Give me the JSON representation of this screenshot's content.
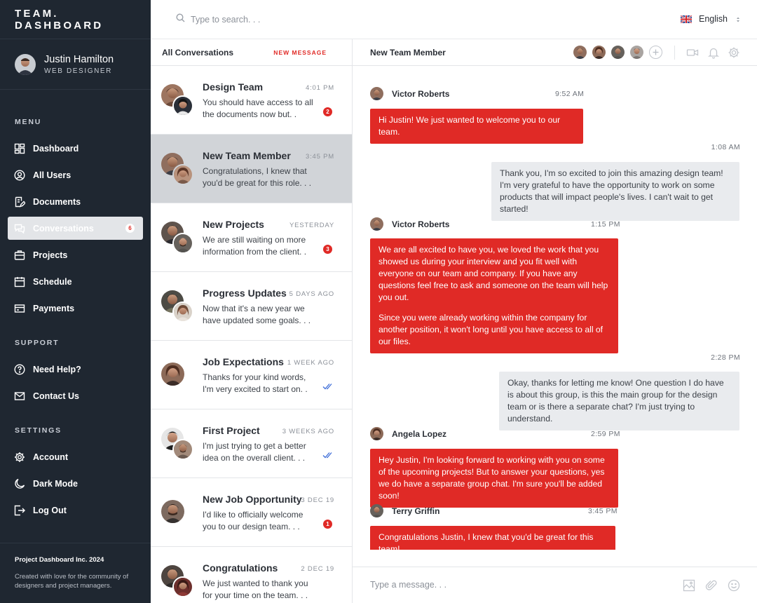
{
  "brand": "TEAM. DASHBOARD",
  "user": {
    "name": "Justin Hamilton",
    "role": "WEB DESIGNER"
  },
  "menu": {
    "title": "MENU",
    "items": [
      {
        "label": "Dashboard",
        "icon": "dashboard-icon"
      },
      {
        "label": "All Users",
        "icon": "user-circle-icon"
      },
      {
        "label": "Documents",
        "icon": "document-icon"
      },
      {
        "label": "Conversations",
        "icon": "chat-icon",
        "badge": "6",
        "active": true
      },
      {
        "label": "Projects",
        "icon": "briefcase-icon"
      },
      {
        "label": "Schedule",
        "icon": "calendar-icon"
      },
      {
        "label": "Payments",
        "icon": "card-icon"
      }
    ]
  },
  "support": {
    "title": "SUPPORT",
    "items": [
      {
        "label": "Need Help?",
        "icon": "question-icon"
      },
      {
        "label": "Contact Us",
        "icon": "mail-icon"
      }
    ]
  },
  "settings": {
    "title": "SETTINGS",
    "items": [
      {
        "label": "Account",
        "icon": "gear-icon"
      },
      {
        "label": "Dark Mode",
        "icon": "moon-icon"
      },
      {
        "label": "Log Out",
        "icon": "logout-icon"
      }
    ]
  },
  "footer": {
    "company": "Project Dashboard Inc. 2024",
    "tagline": "Created with love for the community of designers and project managers."
  },
  "topbar": {
    "search_placeholder": "Type to search. . .",
    "language": "English"
  },
  "conversations": {
    "title": "All Conversations",
    "new_message": "NEW MESSAGE",
    "items": [
      {
        "title": "Design Team",
        "time": "4:01 PM",
        "preview": "You should have access to all the documents now but. .",
        "unread": "2"
      },
      {
        "title": "New Team Member",
        "time": "3:45 PM",
        "preview": "Congratulations, I knew that you'd be great for this role. . .",
        "selected": true
      },
      {
        "title": "New Projects",
        "time": "YESTERDAY",
        "preview": "We are still waiting on more information from the client. .",
        "unread": "3"
      },
      {
        "title": "Progress Updates",
        "time": "5 DAYS AGO",
        "preview": "Now that it's a new year we have updated some goals. . ."
      },
      {
        "title": "Job Expectations",
        "time": "1 WEEK AGO",
        "preview": "Thanks for your kind words, I'm very excited to start on. .",
        "read": true
      },
      {
        "title": "First Project",
        "time": "3 WEEKS AGO",
        "preview": "I'm just trying to get a better idea on the overall client. . .",
        "read": true
      },
      {
        "title": "New Job Opportunity",
        "time": "3 DEC 19",
        "preview": "I'd like to officially welcome you to our design team. . .",
        "unread": "1"
      },
      {
        "title": "Congratulations",
        "time": "2 DEC 19",
        "preview": "We just wanted to thank you for your time on the team. . ."
      }
    ]
  },
  "chat": {
    "title": "New Team Member",
    "messages": [
      {
        "sender": "Victor Roberts",
        "time": "9:52 AM",
        "text": "Hi Justin! We just wanted to welcome you to our team."
      },
      {
        "time": "1:08 AM",
        "text": "Thank you, I'm so excited to join this amazing design team! I'm very grateful to have the opportunity to work on some products that will impact people's lives. I can't wait to get started!"
      },
      {
        "sender": "Victor Roberts",
        "time": "1:15 PM",
        "text": "We are all excited to have you, we loved the work that you showed us during your interview and you fit well with everyone on our team and company. If you have any questions feel free to ask and someone on the team will help you out."
      },
      {
        "text": "Since you were already working within the company for another position, it won't long until you have access to all of our files."
      },
      {
        "time": "2:28 PM",
        "text": "Okay, thanks for letting me know! One question I do have is about this group, is this the main group for the design team or is there a separate chat? I'm just trying to understand."
      },
      {
        "sender": "Angela Lopez",
        "time": "2:59 PM",
        "text": "Hey Justin, I'm looking forward to working with you on some of the upcoming projects! But to answer your questions, yes we do have a separate group chat. I'm sure you'll be added soon!"
      },
      {
        "sender": "Terry Griffin",
        "time": "3:45 PM",
        "text": "Congratulations Justin, I knew that you'd be great for this team!"
      }
    ],
    "composer_placeholder": "Type a message. . ."
  },
  "colors": {
    "accent": "#e02a26",
    "sidebar": "#1f2731",
    "selected_row": "#d1d4d8",
    "incoming_bubble": "#e9ebee"
  }
}
